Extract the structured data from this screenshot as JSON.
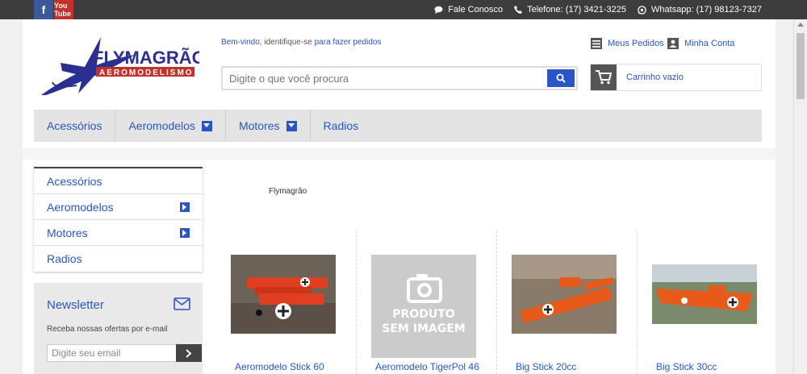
{
  "social": {
    "facebook": "f",
    "youtube": "You Tube"
  },
  "topbar": {
    "contact": "Fale Conosco",
    "phone": "Telefone: (17) 3421-3225",
    "whatsapp": "Whatsapp: (17) 98123-7327"
  },
  "logo": {
    "name": "FLYMAGRÃO",
    "tagline": "AEROMODELISMO"
  },
  "welcome": {
    "prefix": "Bem-vindo,",
    "middle": " identifique-se ",
    "link": "para fazer pedidos"
  },
  "search": {
    "placeholder": "Digite o que você procura"
  },
  "account": {
    "orders": "Meus Pedidos",
    "my_account": "Minha Conta"
  },
  "cart": {
    "label": "Carrinho vazio"
  },
  "nav": {
    "items": [
      {
        "label": "Acessórios"
      },
      {
        "label": "Aeromodelos"
      },
      {
        "label": "Motores"
      },
      {
        "label": "Radios"
      }
    ]
  },
  "sidebar": {
    "items": [
      {
        "label": "Acessórios"
      },
      {
        "label": "Aeromodelos"
      },
      {
        "label": "Motores"
      },
      {
        "label": "Radios"
      }
    ]
  },
  "newsletter": {
    "title": "Newsletter",
    "desc": "Receba nossas ofertas por e-mail",
    "placeholder": "Digite seu email"
  },
  "brand_label": "Flymagrão",
  "products": [
    {
      "name": "Aeromodelo Stick 60"
    },
    {
      "name": "Aeromodelo TigerPol 46",
      "placeholder_line1": "PRODUTO",
      "placeholder_line2": "SEM IMAGEM"
    },
    {
      "name": "Big Stick 20cc"
    },
    {
      "name": "Big Stick 30cc"
    }
  ],
  "colors": {
    "accent": "#2a55c4",
    "topbar": "#3c3c3c",
    "nav_bg": "#e4e4e4"
  }
}
